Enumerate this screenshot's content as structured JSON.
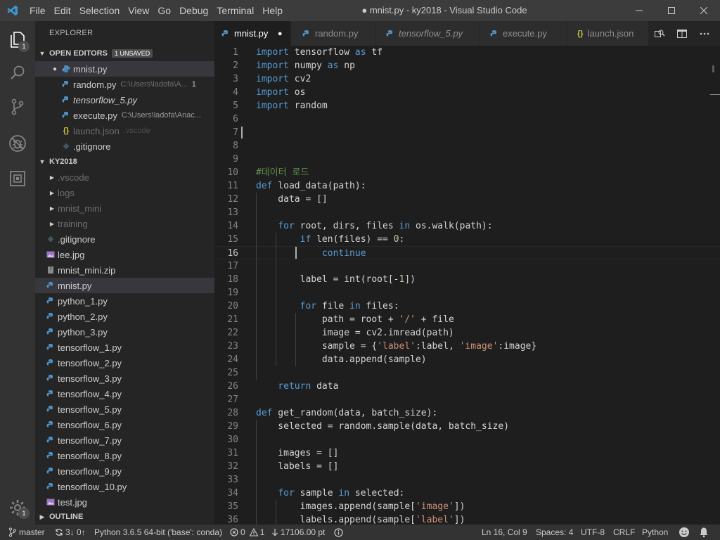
{
  "window": {
    "title": "● mnist.py - ky2018 - Visual Studio Code",
    "menu": [
      "File",
      "Edit",
      "Selection",
      "View",
      "Go",
      "Debug",
      "Terminal",
      "Help"
    ]
  },
  "activity_bar": {
    "explorer_badge": "1",
    "settings_badge": "1"
  },
  "sidebar": {
    "title": "EXPLORER",
    "open_editors": {
      "header": "OPEN EDITORS",
      "unsaved_badge": "1 UNSAVED",
      "items": [
        {
          "name": "mnist.py",
          "path": "",
          "extra": ""
        },
        {
          "name": "random.py",
          "path": "C:\\Users\\ladofa\\A...",
          "extra": "1"
        },
        {
          "name": "tensorflow_5.py",
          "path": "",
          "extra": ""
        },
        {
          "name": "execute.py",
          "path": "C:\\Users\\ladofa\\Anac...",
          "extra": ""
        },
        {
          "name": "launch.json",
          "path": ".vscode",
          "extra": ""
        },
        {
          "name": ".gitignore",
          "path": "",
          "extra": ""
        }
      ]
    },
    "workspace": {
      "header": "KY2018",
      "folders": [
        ".vscode",
        "logs",
        "mnist_mini",
        "training"
      ],
      "files": [
        ".gitignore",
        "lee.jpg",
        "mnist_mini.zip",
        "mnist.py",
        "python_1.py",
        "python_2.py",
        "python_3.py",
        "tensorflow_1.py",
        "tensorflow_2.py",
        "tensorflow_3.py",
        "tensorflow_4.py",
        "tensorflow_5.py",
        "tensorflow_6.py",
        "tensorflow_7.py",
        "tensorflow_8.py",
        "tensorflow_9.py",
        "tensorflow_10.py",
        "test.jpg"
      ]
    },
    "outline_header": "OUTLINE"
  },
  "tabs": [
    {
      "label": "mnist.py"
    },
    {
      "label": "random.py"
    },
    {
      "label": "tensorflow_5.py"
    },
    {
      "label": "execute.py"
    },
    {
      "label": "launch.json"
    }
  ],
  "editor": {
    "lines": [
      "import tensorflow as tf",
      "import numpy as np",
      "import cv2",
      "import os",
      "import random",
      "",
      "",
      "",
      "",
      "#데이터 로드",
      "def load_data(path):",
      "    data = []",
      "",
      "    for root, dirs, files in os.walk(path):",
      "        if len(files) == 0:",
      "            continue",
      "        ",
      "        label = int(root[-1])",
      "",
      "        for file in files:",
      "            path = root + '/' + file",
      "            image = cv2.imread(path)",
      "            sample = {'label':label, 'image':image}",
      "            data.append(sample)",
      "",
      "    return data",
      "",
      "def get_random(data, batch_size):",
      "    selected = random.sample(data, batch_size)",
      "",
      "    images = []",
      "    labels = []",
      "",
      "    for sample in selected:",
      "        images.append(sample['image'])",
      "        labels.append(sample['label'])",
      ""
    ]
  },
  "status": {
    "branch": "master",
    "sync": "3↓ 0↑",
    "interpreter": "Python 3.6.5 64-bit ('base': conda)",
    "errors": "0",
    "warnings": "1",
    "pt": "17106.00 pt",
    "position": "Ln 16, Col 9",
    "spaces": "Spaces: 4",
    "encoding": "UTF-8",
    "eol": "CRLF",
    "language": "Python"
  }
}
